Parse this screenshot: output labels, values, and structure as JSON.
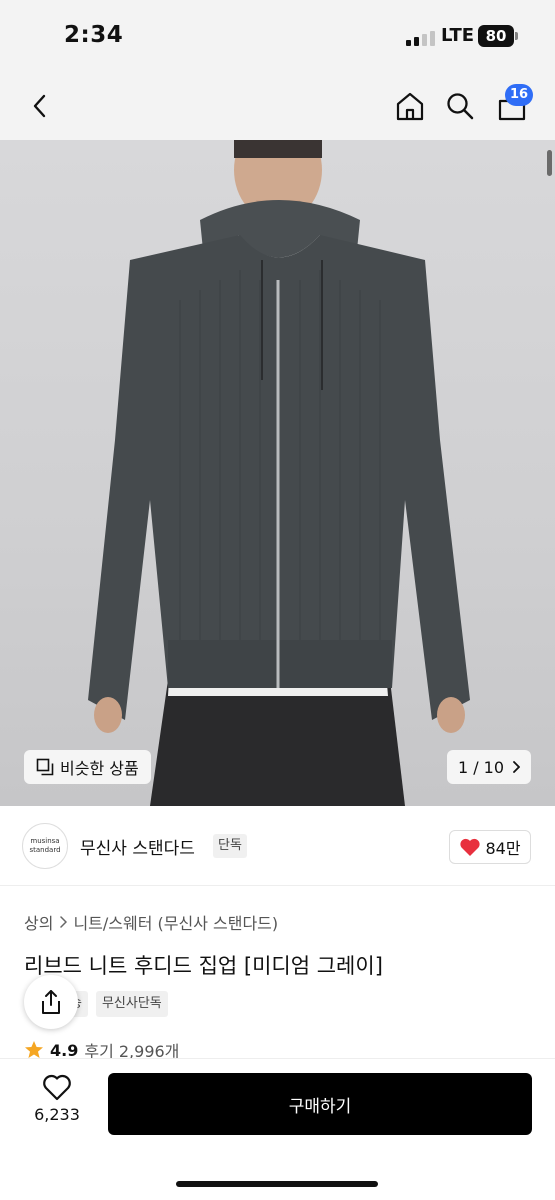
{
  "status_bar": {
    "time": "2:34",
    "network": "LTE",
    "battery": "80"
  },
  "top_nav": {
    "icons": [
      "chevron-left-icon",
      "home-icon",
      "search-icon",
      "bag-icon"
    ],
    "cart_count": "16"
  },
  "gallery": {
    "similar_label": "비슷한 상품",
    "page_indicator": "1 / 10"
  },
  "brand": {
    "logo_line1": "musinsa",
    "logo_line2": "standard",
    "name": "무신사 스탠다드",
    "tag": "단독",
    "likes": "84만"
  },
  "product": {
    "breadcrumb": [
      "상의",
      "니트/스웨터 (무신사 스탠다드)"
    ],
    "title": "리브드 니트 후디드 집업 [미디엄 그레이]",
    "tags": [
      "송",
      "무신사단독"
    ],
    "rating": "4.9",
    "reviews": "후기 2,996개"
  },
  "bottom_bar": {
    "wish_count": "6,233",
    "buy_label": "구매하기"
  },
  "colors": {
    "accent_blue": "#2f6df6",
    "heart_red": "#e8303e",
    "star_orange": "#f5a623",
    "buy_button": "#000000"
  }
}
